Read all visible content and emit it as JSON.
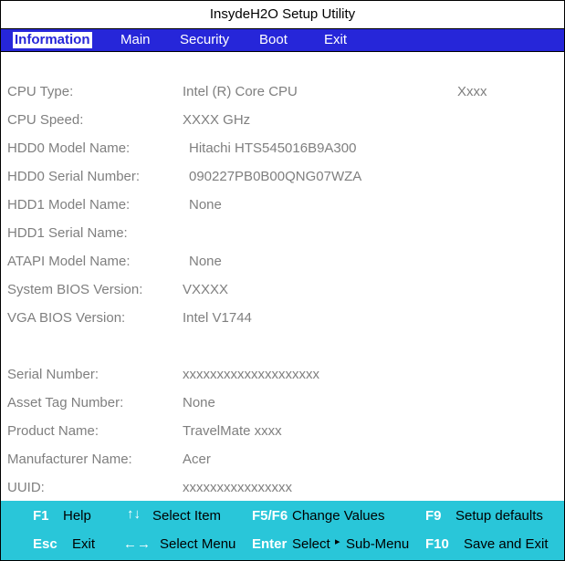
{
  "window": {
    "title": "InsydeH2O Setup Utility"
  },
  "menu": {
    "items": [
      {
        "label": "Information"
      },
      {
        "label": "Main"
      },
      {
        "label": "Security"
      },
      {
        "label": "Boot"
      },
      {
        "label": "Exit"
      }
    ],
    "active": "Information"
  },
  "info": {
    "cpu_type": {
      "label": "CPU Type:",
      "value": "Intel (R) Core CPU",
      "extra": "Xxxx"
    },
    "cpu_speed": {
      "label": "CPU Speed:",
      "value": "XXXX GHz"
    },
    "hdd0_model": {
      "label": "HDD0 Model Name:",
      "value": "Hitachi HTS545016B9A300"
    },
    "hdd0_serial": {
      "label": "HDD0 Serial Number:",
      "value": "090227PB0B00QNG07WZA"
    },
    "hdd1_model": {
      "label": "HDD1 Model Name:",
      "value": "None"
    },
    "hdd1_serial": {
      "label": "HDD1 Serial Name:",
      "value": ""
    },
    "atapi_model": {
      "label": "ATAPI Model Name:",
      "value": "None"
    },
    "system_bios": {
      "label": "System BIOS Version:",
      "value": "VXXXX"
    },
    "vga_bios": {
      "label": "VGA BIOS Version:",
      "value": "Intel V1744"
    },
    "serial_number": {
      "label": "Serial Number:",
      "value": "xxxxxxxxxxxxxxxxxxxx"
    },
    "asset_tag": {
      "label": "Asset Tag Number:",
      "value": "None"
    },
    "product_name": {
      "label": "Product Name:",
      "value": "TravelMate xxxx"
    },
    "manufacturer": {
      "label": "Manufacturer Name:",
      "value": "Acer"
    },
    "uuid": {
      "label": "UUID:",
      "value": "xxxxxxxxxxxxxxxx"
    }
  },
  "footer": {
    "f1": {
      "key": "F1",
      "action": "Help"
    },
    "select_item": {
      "arrows": "↑↓",
      "action": "Select Item"
    },
    "f5f6": {
      "key": "F5/F6",
      "action": "Change Values"
    },
    "f9": {
      "key": "F9",
      "action": "Setup defaults"
    },
    "esc": {
      "key": "Esc",
      "action": "Exit"
    },
    "select_menu": {
      "arrows": "←→",
      "action": "Select Menu"
    },
    "enter": {
      "key": "Enter",
      "action_pre": "Select",
      "pointer": "▸",
      "action_post": "Sub-Menu"
    },
    "f10": {
      "key": "F10",
      "action": "Save and Exit"
    }
  }
}
